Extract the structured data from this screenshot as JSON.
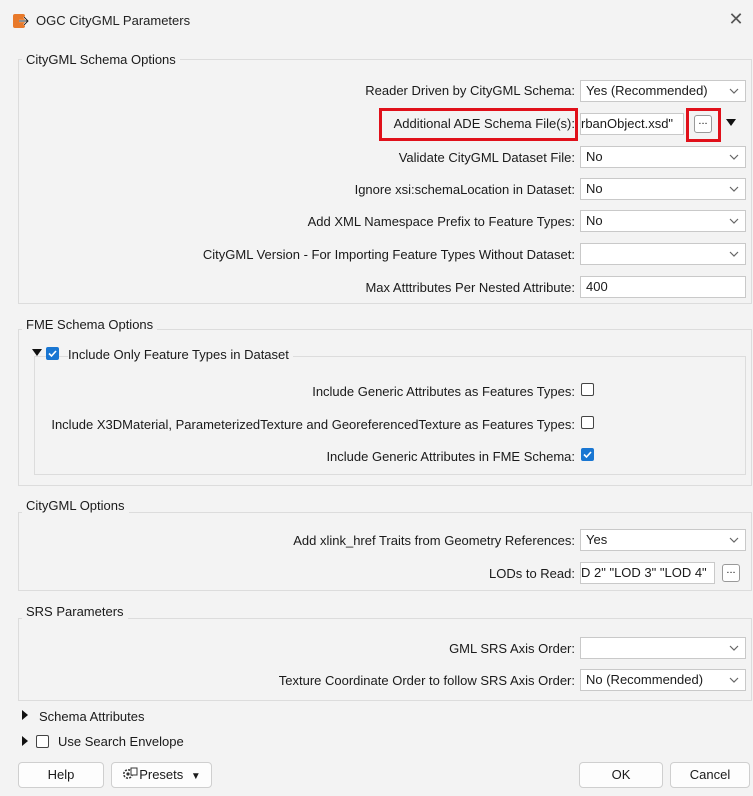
{
  "window": {
    "title": "OGC CityGML Parameters"
  },
  "schema_options": {
    "title": "CityGML Schema Options",
    "reader_driven": {
      "label": "Reader Driven by CityGML Schema:",
      "value": "Yes (Recommended)"
    },
    "ade_schema": {
      "label": "Additional ADE Schema File(s):",
      "value": "rbanObject.xsd\"",
      "browse": "..."
    },
    "validate": {
      "label": "Validate CityGML Dataset File:",
      "value": "No"
    },
    "ignore_xsi": {
      "label": "Ignore xsi:schemaLocation in Dataset:",
      "value": "No"
    },
    "add_ns_prefix": {
      "label": "Add XML Namespace Prefix to Feature Types:",
      "value": "No"
    },
    "citygml_version": {
      "label": "CityGML Version - For Importing Feature Types Without Dataset:",
      "value": ""
    },
    "max_attributes": {
      "label": "Max Atttributes Per Nested Attribute:",
      "value": "400"
    }
  },
  "fme_schema": {
    "title": "FME Schema Options",
    "include_only": {
      "label": "Include Only Feature Types in Dataset",
      "checked": true
    },
    "generic_as_features": {
      "label": "Include Generic Attributes as Features Types:",
      "checked": false
    },
    "x3d_as_features": {
      "label": "Include X3DMaterial, ParameterizedTexture and GeoreferencedTexture as Features Types:",
      "checked": false
    },
    "generic_in_schema": {
      "label": "Include Generic Attributes in FME Schema:",
      "checked": true
    }
  },
  "citygml_options": {
    "title": "CityGML Options",
    "xlink": {
      "label": "Add xlink_href Traits from Geometry References:",
      "value": "Yes"
    },
    "lods": {
      "label": "LODs to Read:",
      "value": "D 2\" \"LOD 3\" \"LOD 4\"",
      "browse": "..."
    }
  },
  "srs": {
    "title": "SRS Parameters",
    "axis_order": {
      "label": "GML SRS Axis Order:",
      "value": ""
    },
    "texture_order": {
      "label": "Texture Coordinate Order to follow SRS Axis Order:",
      "value": "No (Recommended)"
    }
  },
  "collapsed": {
    "schema_attributes": "Schema Attributes",
    "search_envelope": {
      "label": "Use Search Envelope",
      "checked": false
    }
  },
  "buttons": {
    "help": "Help",
    "presets": "Presets",
    "ok": "OK",
    "cancel": "Cancel"
  },
  "colors": {
    "highlight": "#e0101a",
    "checkbox_on": "#1976d2",
    "app_icon": "#e8792a"
  }
}
